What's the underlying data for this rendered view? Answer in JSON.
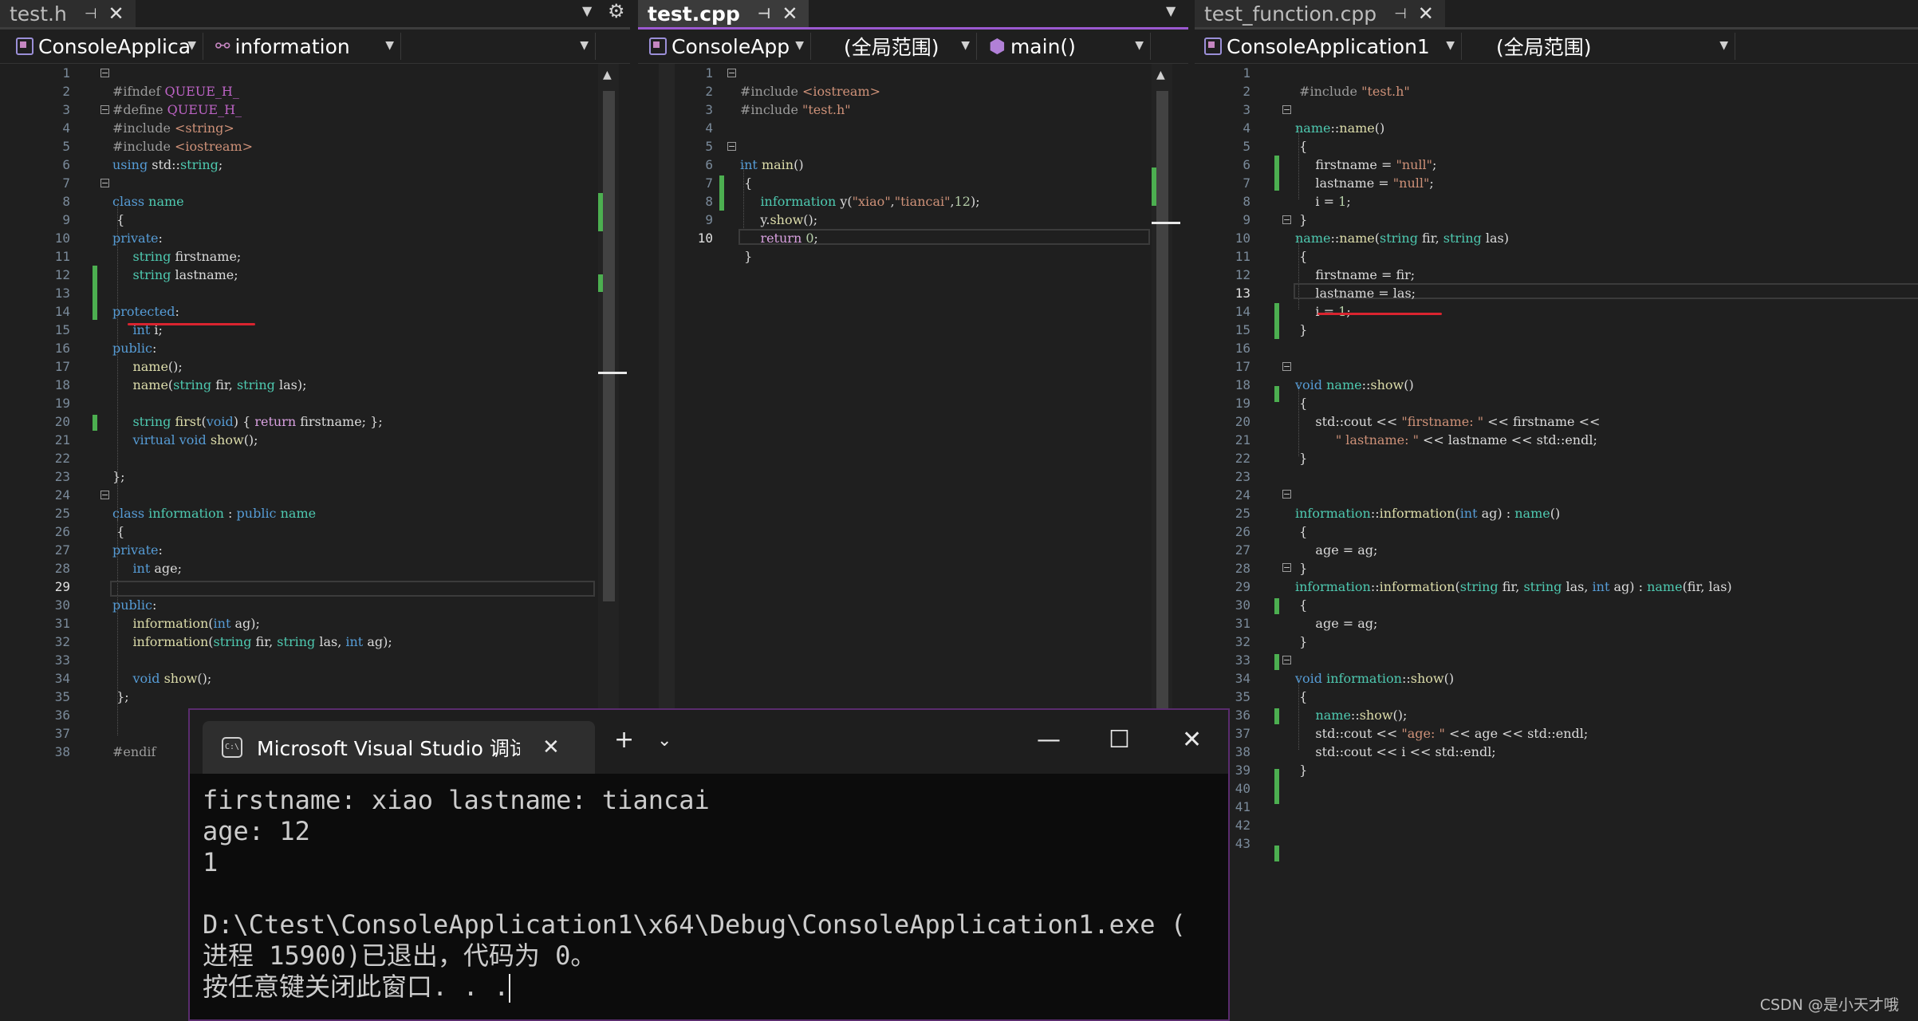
{
  "left_pane": {
    "tab_title": "test.h",
    "project": "ConsoleApplica",
    "scope": "information",
    "current_line": 29,
    "line_numbers": [
      "1",
      "2",
      "3",
      "4",
      "5",
      "6",
      "7",
      "8",
      "9",
      "10",
      "11",
      "12",
      "13",
      "14",
      "15",
      "16",
      "17",
      "18",
      "19",
      "20",
      "21",
      "22",
      "23",
      "24",
      "25",
      "26",
      "27",
      "28",
      "29",
      "30",
      "31",
      "32",
      "33",
      "34",
      "35",
      "36",
      "37",
      "38"
    ]
  },
  "middle_pane": {
    "tab_title": "test.cpp",
    "project": "ConsoleApp",
    "scope": "(全局范围)",
    "member": "main()",
    "current_line": 10,
    "line_numbers": [
      "1",
      "2",
      "3",
      "4",
      "5",
      "6",
      "7",
      "8",
      "9",
      "10"
    ]
  },
  "right_pane": {
    "tab_title": "test_function.cpp",
    "project": "ConsoleApplication1",
    "scope": "(全局范围)",
    "current_line": 13,
    "line_numbers": [
      "1",
      "2",
      "3",
      "4",
      "5",
      "6",
      "7",
      "8",
      "9",
      "10",
      "11",
      "12",
      "13",
      "14",
      "15",
      "16",
      "17",
      "18",
      "19",
      "20",
      "21",
      "22",
      "23",
      "24",
      "25",
      "26",
      "27",
      "28",
      "29",
      "30",
      "31",
      "32",
      "33",
      "34",
      "35",
      "36",
      "37",
      "38",
      "39",
      "40",
      "41",
      "42",
      "43"
    ]
  },
  "console": {
    "title": "Microsoft Visual Studio 调试控制台",
    "lines": [
      "firstname: xiao lastname: tiancai",
      "age: 12",
      "1",
      "",
      "D:\\Ctest\\ConsoleApplication1\\x64\\Debug\\ConsoleApplication1.exe (",
      "进程 15900)已退出，代码为 0。",
      "按任意键关闭此窗口. . ."
    ]
  },
  "watermark": "CSDN @是小天才哦",
  "colors": {
    "keyword": "#569cd6",
    "type": "#4ec9b0",
    "function": "#dcdcaa",
    "string": "#ce9178",
    "number": "#b5cea8",
    "control": "#d8a0df",
    "active_tab_accent": "#9b59d0",
    "change_bar": "#4caf50",
    "annotation_red": "#d9242f"
  }
}
